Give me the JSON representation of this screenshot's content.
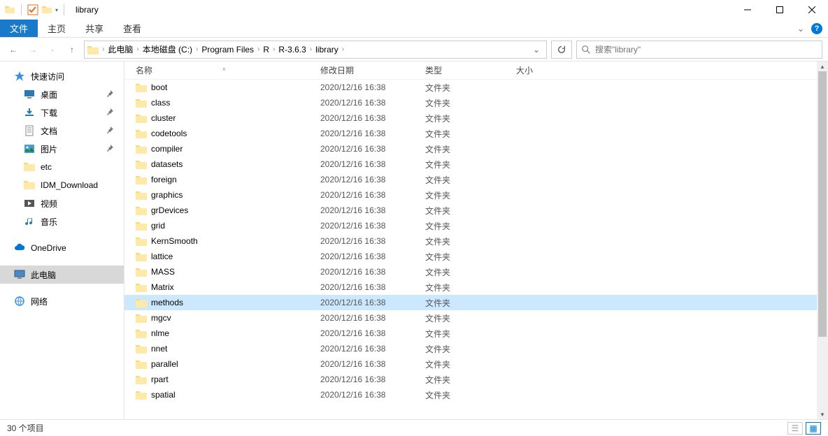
{
  "window": {
    "title": "library",
    "tabs": {
      "file": "文件",
      "home": "主页",
      "share": "共享",
      "view": "查看"
    }
  },
  "breadcrumb": [
    "此电脑",
    "本地磁盘 (C:)",
    "Program Files",
    "R",
    "R-3.6.3",
    "library"
  ],
  "search": {
    "placeholder": "搜索\"library\""
  },
  "sidebar": {
    "quick_access": "快速访问",
    "items": [
      {
        "label": "桌面",
        "pinned": true
      },
      {
        "label": "下载",
        "pinned": true
      },
      {
        "label": "文档",
        "pinned": true
      },
      {
        "label": "图片",
        "pinned": true
      },
      {
        "label": "etc",
        "pinned": false
      },
      {
        "label": "IDM_Download",
        "pinned": false
      },
      {
        "label": "视频",
        "pinned": false
      },
      {
        "label": "音乐",
        "pinned": false
      }
    ],
    "onedrive": "OneDrive",
    "this_pc": "此电脑",
    "network": "网络"
  },
  "columns": {
    "name": "名称",
    "date": "修改日期",
    "type": "类型",
    "size": "大小"
  },
  "rows": [
    {
      "name": "boot",
      "date": "2020/12/16 16:38",
      "type": "文件夹"
    },
    {
      "name": "class",
      "date": "2020/12/16 16:38",
      "type": "文件夹"
    },
    {
      "name": "cluster",
      "date": "2020/12/16 16:38",
      "type": "文件夹"
    },
    {
      "name": "codetools",
      "date": "2020/12/16 16:38",
      "type": "文件夹"
    },
    {
      "name": "compiler",
      "date": "2020/12/16 16:38",
      "type": "文件夹"
    },
    {
      "name": "datasets",
      "date": "2020/12/16 16:38",
      "type": "文件夹"
    },
    {
      "name": "foreign",
      "date": "2020/12/16 16:38",
      "type": "文件夹"
    },
    {
      "name": "graphics",
      "date": "2020/12/16 16:38",
      "type": "文件夹"
    },
    {
      "name": "grDevices",
      "date": "2020/12/16 16:38",
      "type": "文件夹"
    },
    {
      "name": "grid",
      "date": "2020/12/16 16:38",
      "type": "文件夹"
    },
    {
      "name": "KernSmooth",
      "date": "2020/12/16 16:38",
      "type": "文件夹"
    },
    {
      "name": "lattice",
      "date": "2020/12/16 16:38",
      "type": "文件夹"
    },
    {
      "name": "MASS",
      "date": "2020/12/16 16:38",
      "type": "文件夹"
    },
    {
      "name": "Matrix",
      "date": "2020/12/16 16:38",
      "type": "文件夹"
    },
    {
      "name": "methods",
      "date": "2020/12/16 16:38",
      "type": "文件夹",
      "highlight": true
    },
    {
      "name": "mgcv",
      "date": "2020/12/16 16:38",
      "type": "文件夹"
    },
    {
      "name": "nlme",
      "date": "2020/12/16 16:38",
      "type": "文件夹"
    },
    {
      "name": "nnet",
      "date": "2020/12/16 16:38",
      "type": "文件夹"
    },
    {
      "name": "parallel",
      "date": "2020/12/16 16:38",
      "type": "文件夹"
    },
    {
      "name": "rpart",
      "date": "2020/12/16 16:38",
      "type": "文件夹"
    },
    {
      "name": "spatial",
      "date": "2020/12/16 16:38",
      "type": "文件夹"
    }
  ],
  "status": {
    "item_count": "30 个项目"
  }
}
